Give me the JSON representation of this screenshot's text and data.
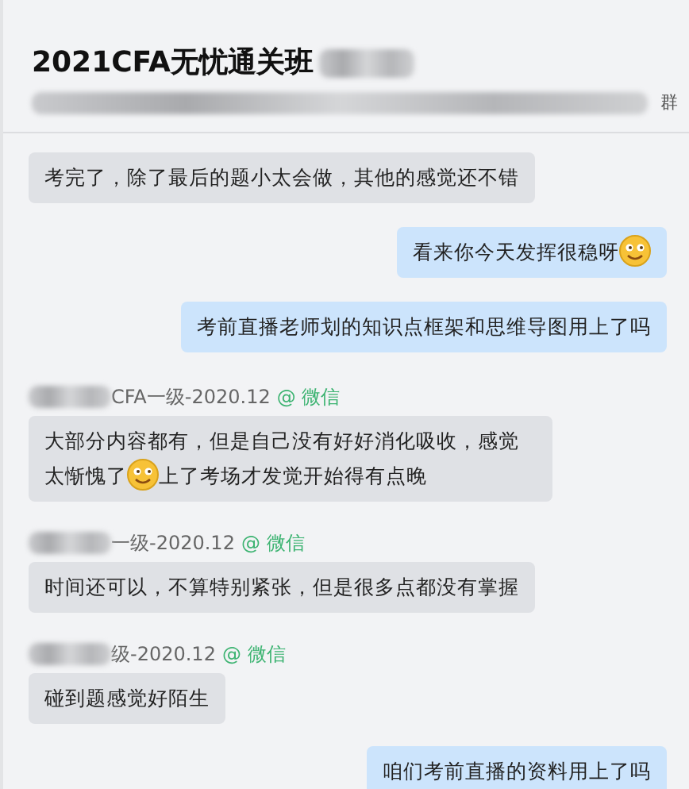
{
  "header": {
    "title": "2021CFA无忧通关班",
    "subtitle_suffix": "群"
  },
  "messages": [
    {
      "kind": "incoming",
      "parts": [
        {
          "kind": "text",
          "text": "考完了，除了最后的题小太会做，其他的感觉还不错"
        }
      ]
    },
    {
      "kind": "outgoing",
      "parts": [
        {
          "kind": "text",
          "text": "看来你今天发挥很稳呀"
        },
        {
          "kind": "emoji"
        }
      ]
    },
    {
      "kind": "outgoing",
      "parts": [
        {
          "kind": "text",
          "text": "考前直播老师划的知识点框架和思维导图用上了吗"
        }
      ]
    },
    {
      "kind": "incoming",
      "sender": {
        "name": "CFA一级-2020.12",
        "source": "@ 微信"
      },
      "parts": [
        {
          "kind": "text",
          "text": "大部分内容都有，但是自己没有好好消化吸收，感觉太惭愧了"
        },
        {
          "kind": "emoji"
        },
        {
          "kind": "text",
          "text": "上了考场才发觉开始得有点晚"
        }
      ]
    },
    {
      "kind": "incoming",
      "sender": {
        "name": "一级-2020.12",
        "source": "@ 微信"
      },
      "parts": [
        {
          "kind": "text",
          "text": "时间还可以，不算特别紧张，但是很多点都没有掌握"
        }
      ]
    },
    {
      "kind": "incoming",
      "sender": {
        "name": "级-2020.12",
        "source": "@ 微信"
      },
      "parts": [
        {
          "kind": "text",
          "text": "碰到题感觉好陌生"
        }
      ]
    },
    {
      "kind": "outgoing",
      "parts": [
        {
          "kind": "text",
          "text": "咱们考前直播的资料用上了吗"
        }
      ]
    }
  ]
}
